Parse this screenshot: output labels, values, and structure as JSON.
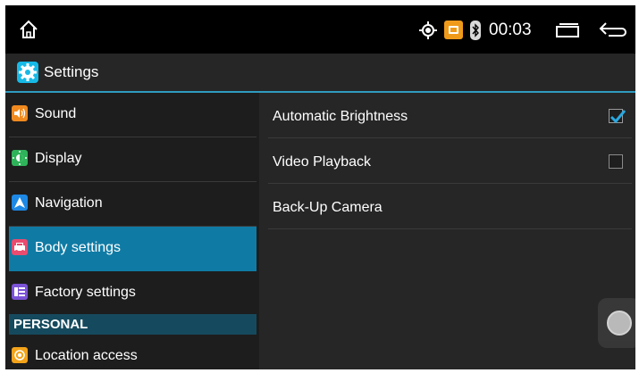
{
  "status_bar": {
    "time": "00:03",
    "icons": [
      "home-icon",
      "location-icon",
      "orange-app-icon",
      "bluetooth-icon",
      "recents-icon",
      "back-icon"
    ]
  },
  "app_bar": {
    "title": "Settings",
    "icon": "gear-icon",
    "accent": "#2f9bbf"
  },
  "sidebar": {
    "items": [
      {
        "label": "Sound",
        "icon": "speaker-icon",
        "color": "#f08a1f"
      },
      {
        "label": "Display",
        "icon": "display-icon",
        "color": "#2fb35a"
      },
      {
        "label": "Navigation",
        "icon": "navigation-icon",
        "color": "#1e88e5"
      },
      {
        "label": "Body settings",
        "icon": "car-icon",
        "color": "#e84c6e",
        "selected": true
      },
      {
        "label": "Factory settings",
        "icon": "factory-icon",
        "color": "#7b53d6"
      }
    ],
    "section_personal": "PERSONAL",
    "personal_items": [
      {
        "label": "Location access",
        "icon": "location-access-icon",
        "color": "#f3a31a"
      }
    ],
    "selected_color": "#0f7ba5"
  },
  "main": {
    "preferences": [
      {
        "label": "Automatic Brightness",
        "checkbox": true,
        "checked": true
      },
      {
        "label": "Video Playback",
        "checkbox": true,
        "checked": false
      },
      {
        "label": "Back-Up Camera",
        "checkbox": false
      }
    ]
  },
  "assistive_button": {
    "icon": "assistive-touch-icon"
  }
}
